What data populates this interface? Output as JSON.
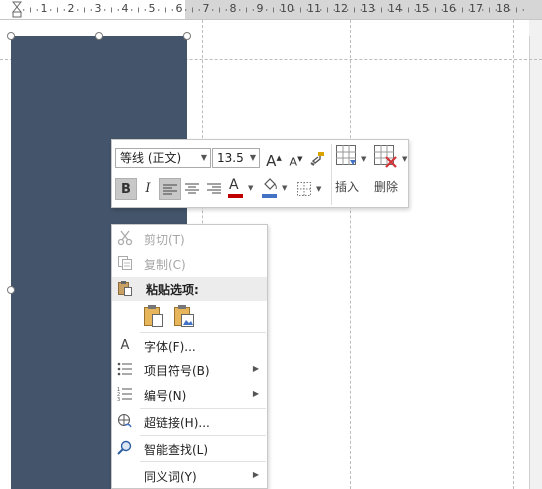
{
  "ruler": {
    "marks": [
      "1",
      "2",
      "3",
      "4",
      "5",
      "6",
      "7",
      "8",
      "9",
      "10",
      "11",
      "12",
      "13",
      "14",
      "15",
      "16",
      "17",
      "18"
    ]
  },
  "mini_toolbar": {
    "font_name": "等线 (正文)",
    "font_size": "13.5",
    "grow_font": "A",
    "shrink_font": "A",
    "bold": "B",
    "italic": "I",
    "font_color_label": "A",
    "font_color": "#c00000",
    "highlight_color": "#4472c4",
    "insert_label": "插入",
    "delete_label": "删除"
  },
  "context_menu": {
    "cut": "剪切(T)",
    "copy": "复制(C)",
    "paste_options": "粘贴选项:",
    "font": "字体(F)...",
    "bullets": "项目符号(B)",
    "numbering": "编号(N)",
    "hyperlink": "超链接(H)...",
    "smart_lookup": "智能查找(L)",
    "synonyms": "同义词(Y)"
  },
  "colors": {
    "shape_fill": "#44546a"
  }
}
